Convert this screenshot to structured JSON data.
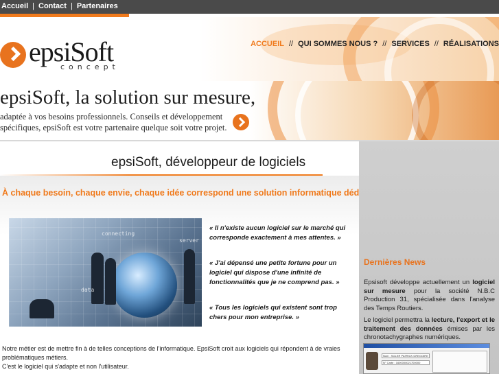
{
  "topbar": {
    "links": [
      "Accueil",
      "Contact",
      "Partenaires"
    ],
    "separator": "|"
  },
  "logo": {
    "name": "epsiSoft",
    "sub": "concept"
  },
  "nav": {
    "items": [
      "ACCUEIL",
      "QUI SOMMES NOUS ?",
      "SERVICES",
      "RÉALISATIONS"
    ],
    "separator": "//",
    "active_index": 0
  },
  "banner": {
    "title": "epsiSoft, la solution sur mesure,",
    "description": "adaptée à vos besoins professionnels. Conseils et développement spécifiques, epsiSoft est votre partenaire quelque soit votre projet."
  },
  "main": {
    "heading": "epsiSoft, développeur de logiciels",
    "tagline": "À chaque besoin, chaque envie, chaque idée correspond une solution informatique dédiée",
    "photo_words": [
      "connecting",
      "server",
      "data"
    ],
    "quotes": [
      "« Il n'existe aucun logiciel sur le marché qui corresponde exactement à mes attentes. »",
      "« J'ai dépensé une petite fortune pour un logiciel qui dispose d'une infinité de fonctionnalités que je ne comprend pas. »",
      "« Tous les logiciels qui existent sont trop chers pour mon entreprise. »"
    ],
    "bottom_text": [
      "Notre métier est de mettre fin à de telles conceptions de l'informatique. EpsiSoft croit aux logiciels qui répondent à de vraies problématiques métiers.",
      "C'est le logiciel qui s'adapte et non l'utilisateur."
    ]
  },
  "news": {
    "title": "Dernières News",
    "p1_pre": "Epsisoft développe actuellement un ",
    "p1_bold": "logiciel sur mesure",
    "p1_post": " pour la société N.B.C Production 31, spécialisée dans l'analyse des Temps Routiers.",
    "p2_pre": "Le logiciel permettra la ",
    "p2_bold": "lecture, l'export et le traitement des données",
    "p2_post": " émises par les chronotachygraphes numériques.",
    "screenshot_fields": [
      "Nom : SOLER PATRICK GREGOIRE",
      "N° Carte : 1600000021700000"
    ]
  },
  "colors": {
    "accent": "#f07a1c",
    "topbar": "#4a4a4a",
    "sidebar": "#c8c8c8"
  }
}
